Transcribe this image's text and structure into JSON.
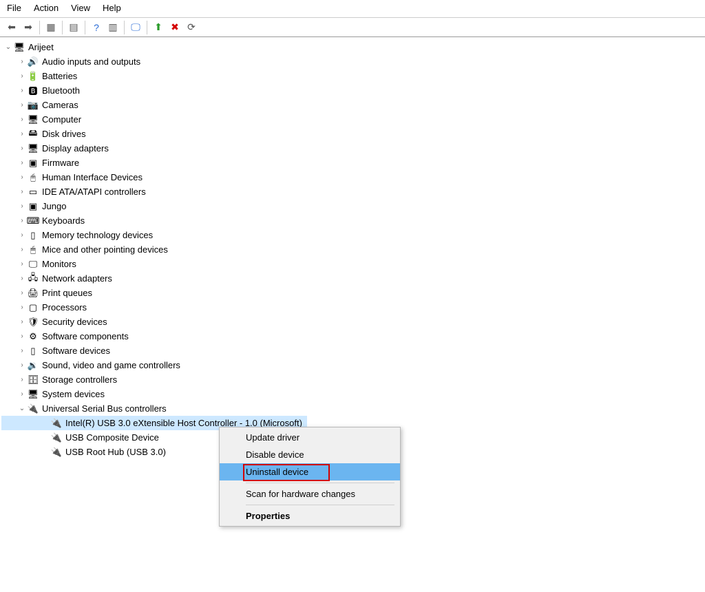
{
  "menu": {
    "file": "File",
    "action": "Action",
    "view": "View",
    "help": "Help"
  },
  "root": {
    "name": "Arijeet"
  },
  "categories": [
    {
      "label": "Audio inputs and outputs",
      "icon": "🔊"
    },
    {
      "label": "Batteries",
      "icon": "🔋"
    },
    {
      "label": "Bluetooth",
      "icon": "🅱"
    },
    {
      "label": "Cameras",
      "icon": "📷"
    },
    {
      "label": "Computer",
      "icon": "🖥"
    },
    {
      "label": "Disk drives",
      "icon": "🖴"
    },
    {
      "label": "Display adapters",
      "icon": "🖥"
    },
    {
      "label": "Firmware",
      "icon": "▣"
    },
    {
      "label": "Human Interface Devices",
      "icon": "🖰"
    },
    {
      "label": "IDE ATA/ATAPI controllers",
      "icon": "▭"
    },
    {
      "label": "Jungo",
      "icon": "▣"
    },
    {
      "label": "Keyboards",
      "icon": "⌨"
    },
    {
      "label": "Memory technology devices",
      "icon": "▯"
    },
    {
      "label": "Mice and other pointing devices",
      "icon": "🖱"
    },
    {
      "label": "Monitors",
      "icon": "🖵"
    },
    {
      "label": "Network adapters",
      "icon": "🖧"
    },
    {
      "label": "Print queues",
      "icon": "🖨"
    },
    {
      "label": "Processors",
      "icon": "▢"
    },
    {
      "label": "Security devices",
      "icon": "🛡"
    },
    {
      "label": "Software components",
      "icon": "⚙"
    },
    {
      "label": "Software devices",
      "icon": "▯"
    },
    {
      "label": "Sound, video and game controllers",
      "icon": "🔉"
    },
    {
      "label": "Storage controllers",
      "icon": "🗄"
    },
    {
      "label": "System devices",
      "icon": "🖥"
    }
  ],
  "usb": {
    "label": "Universal Serial Bus controllers",
    "icon": "🔌",
    "children": [
      {
        "label": "Intel(R) USB 3.0 eXtensible Host Controller - 1.0 (Microsoft)",
        "selected": true
      },
      {
        "label": "USB Composite Device"
      },
      {
        "label": "USB Root Hub (USB 3.0)"
      }
    ]
  },
  "context_menu": {
    "update": "Update driver",
    "disable": "Disable device",
    "uninstall": "Uninstall device",
    "scan": "Scan for hardware changes",
    "properties": "Properties"
  }
}
